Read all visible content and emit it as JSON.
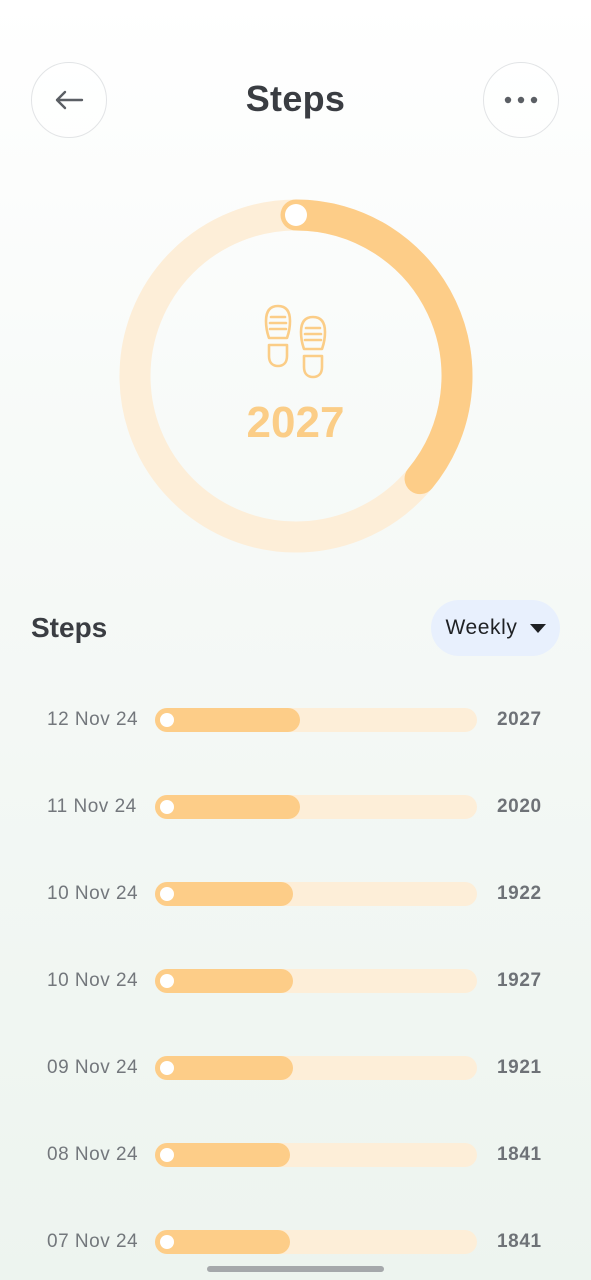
{
  "header": {
    "title": "Steps",
    "back_icon": "arrow-left-icon",
    "more_icon": "more-horizontal-icon"
  },
  "summary": {
    "value": "2027",
    "progress_fraction": 0.36,
    "icon": "footprints-icon",
    "colors": {
      "track": "#fdeed8",
      "fill": "#fdcd88",
      "value": "#fbcd87"
    }
  },
  "history": {
    "title": "Steps",
    "period_label": "Weekly",
    "rows": [
      {
        "date": "12 Nov 24",
        "value": "2027",
        "fraction": 0.45
      },
      {
        "date": "11 Nov 24",
        "value": "2020",
        "fraction": 0.45
      },
      {
        "date": "10 Nov 24",
        "value": "1922",
        "fraction": 0.43
      },
      {
        "date": "10 Nov 24",
        "value": "1927",
        "fraction": 0.43
      },
      {
        "date": "09 Nov 24",
        "value": "1921",
        "fraction": 0.43
      },
      {
        "date": "08 Nov 24",
        "value": "1841",
        "fraction": 0.42
      },
      {
        "date": "07 Nov 24",
        "value": "1841",
        "fraction": 0.42
      }
    ]
  }
}
